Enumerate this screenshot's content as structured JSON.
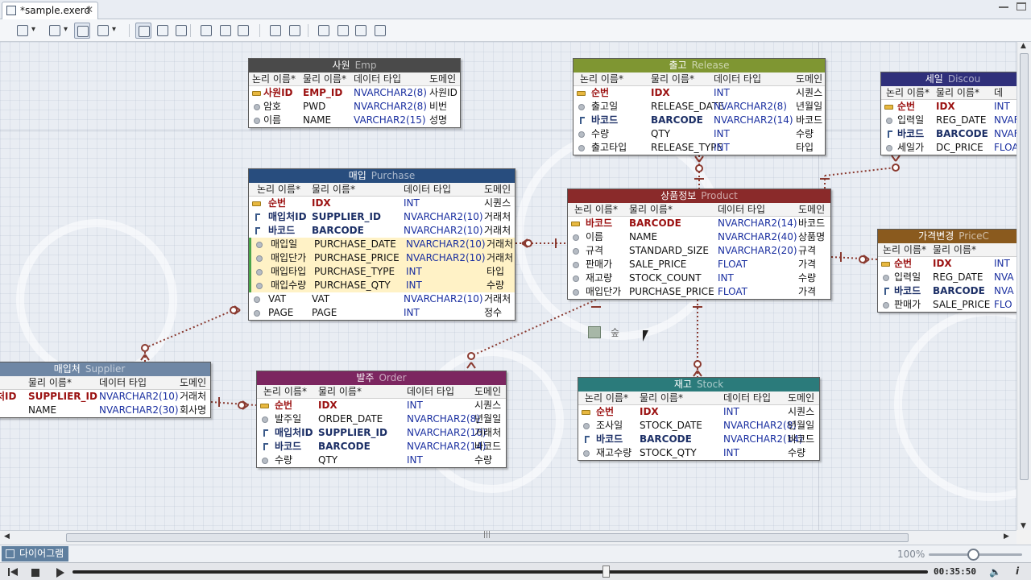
{
  "tabbar": {
    "file_tab": "*sample.exerd",
    "close": "✕"
  },
  "toolbar": {
    "icons": [
      "layout-icon",
      "paint-icon",
      "table-icon",
      "page-icon",
      "pointer-icon",
      "hand-icon",
      "zoom-icon",
      "entity-icon",
      "relation-icon",
      "link-icon",
      "text-icon",
      "print-icon",
      "export-icon",
      "import-icon",
      "sync-icon",
      "help-icon"
    ]
  },
  "colors": {
    "emp": "#4a4a4a",
    "release": "#7f9632",
    "product": "#8a2a2a",
    "purchase": "#284d7e",
    "discount": "#2f2f7a",
    "price": "#8a5a1e",
    "supplier": "#6f87a5",
    "order": "#7c2660",
    "stock": "#2b7b7b",
    "link": "#8a3a30"
  },
  "entities": [
    {
      "key": "emp",
      "ko": "사원",
      "en": "Emp",
      "cols": [
        "논리 이름*",
        "물리 이름*",
        "데이터 타입",
        "도메인"
      ],
      "rows": [
        {
          "kind": "pk",
          "logical": "사원ID",
          "physical": "EMP_ID",
          "type": "NVARCHAR2(8)",
          "domain": "사원ID"
        },
        {
          "kind": "n",
          "logical": "암호",
          "physical": "PWD",
          "type": "NVARCHAR2(8)",
          "domain": "비번"
        },
        {
          "kind": "n",
          "logical": "이름",
          "physical": "NAME",
          "type": "VARCHAR2(15)",
          "domain": "성명"
        }
      ]
    },
    {
      "key": "release",
      "ko": "출고",
      "en": "Release",
      "cols": [
        "논리 이름*",
        "물리 이름*",
        "데이터 타입",
        "도메인"
      ],
      "rows": [
        {
          "kind": "pk",
          "logical": "순번",
          "physical": "IDX",
          "type": "INT",
          "domain": "시퀀스"
        },
        {
          "kind": "n",
          "logical": "출고일",
          "physical": "RELEASE_DATE",
          "type": "NVARCHAR2(8)",
          "domain": "년월일"
        },
        {
          "kind": "fk",
          "logical": "바코드",
          "physical": "BARCODE",
          "type": "NVARCHAR2(14)",
          "domain": "바코드"
        },
        {
          "kind": "n",
          "logical": "수량",
          "physical": "QTY",
          "type": "INT",
          "domain": "수량"
        },
        {
          "kind": "n",
          "logical": "출고타입",
          "physical": "RELEASE_TYPE",
          "type": "INT",
          "domain": "타입"
        }
      ]
    },
    {
      "key": "discount",
      "ko": "세일",
      "en": "Discou",
      "cols": [
        "논리 이름*",
        "물리 이름*",
        "데"
      ],
      "rows": [
        {
          "kind": "pk",
          "logical": "순번",
          "physical": "IDX",
          "type": "INT",
          "domain": ""
        },
        {
          "kind": "n",
          "logical": "입력일",
          "physical": "REG_DATE",
          "type": "NVAF",
          "domain": ""
        },
        {
          "kind": "fk",
          "logical": "바코드",
          "physical": "BARCODE",
          "type": "NVAF",
          "domain": ""
        },
        {
          "kind": "n",
          "logical": "세일가",
          "physical": "DC_PRICE",
          "type": "FLOA",
          "domain": ""
        }
      ]
    },
    {
      "key": "purchase",
      "ko": "매입",
      "en": "Purchase",
      "cols": [
        "논리 이름*",
        "물리 이름*",
        "데이터 타입",
        "도메인"
      ],
      "rows": [
        {
          "kind": "pk",
          "logical": "순번",
          "physical": "IDX",
          "type": "INT",
          "domain": "시퀀스"
        },
        {
          "kind": "fk",
          "logical": "매입처ID",
          "physical": "SUPPLIER_ID",
          "type": "NVARCHAR2(10)",
          "domain": "거래처"
        },
        {
          "kind": "fk",
          "logical": "바코드",
          "physical": "BARCODE",
          "type": "NVARCHAR2(10)",
          "domain": "거래처"
        },
        {
          "kind": "n",
          "hl": true,
          "logical": "매입일",
          "physical": "PURCHASE_DATE",
          "type": "NVARCHAR2(10)",
          "domain": "거래처"
        },
        {
          "kind": "n",
          "hl": true,
          "logical": "매입단가",
          "physical": "PURCHASE_PRICE",
          "type": "NVARCHAR2(10)",
          "domain": "거래처"
        },
        {
          "kind": "n",
          "hl": true,
          "logical": "매입타입",
          "physical": "PURCHASE_TYPE",
          "type": "INT",
          "domain": "타입"
        },
        {
          "kind": "n",
          "hl": true,
          "logical": "매입수량",
          "physical": "PURCHASE_QTY",
          "type": "INT",
          "domain": "수량"
        },
        {
          "kind": "n",
          "logical": "VAT",
          "physical": "VAT",
          "type": "NVARCHAR2(10)",
          "domain": "거래처"
        },
        {
          "kind": "n",
          "logical": "PAGE",
          "physical": "PAGE",
          "type": "INT",
          "domain": "정수"
        }
      ]
    },
    {
      "key": "product",
      "ko": "상품정보",
      "en": "Product",
      "cols": [
        "논리 이름*",
        "물리 이름*",
        "데이터 타입",
        "도메인"
      ],
      "rows": [
        {
          "kind": "pk",
          "logical": "바코드",
          "physical": "BARCODE",
          "type": "NVARCHAR2(14)",
          "domain": "바코드"
        },
        {
          "kind": "n",
          "logical": "이름",
          "physical": "NAME",
          "type": "NVARCHAR2(40)",
          "domain": "상품명"
        },
        {
          "kind": "n",
          "logical": "규격",
          "physical": "STANDARD_SIZE",
          "type": "NVARCHAR2(20)",
          "domain": "규격"
        },
        {
          "kind": "n",
          "logical": "판매가",
          "physical": "SALE_PRICE",
          "type": "FLOAT",
          "domain": "가격"
        },
        {
          "kind": "n",
          "logical": "재고량",
          "physical": "STOCK_COUNT",
          "type": "INT",
          "domain": "수량"
        },
        {
          "kind": "n",
          "logical": "매입단가",
          "physical": "PURCHASE_PRICE",
          "type": "FLOAT",
          "domain": "가격"
        }
      ]
    },
    {
      "key": "price",
      "ko": "가격변경",
      "en": "PriceC",
      "cols": [
        "논리 이름*",
        "물리 이름*",
        ""
      ],
      "rows": [
        {
          "kind": "pk",
          "logical": "순번",
          "physical": "IDX",
          "type": "INT",
          "domain": ""
        },
        {
          "kind": "n",
          "logical": "입력일",
          "physical": "REG_DATE",
          "type": "NVA",
          "domain": ""
        },
        {
          "kind": "fk",
          "logical": "바코드",
          "physical": "BARCODE",
          "type": "NVA",
          "domain": ""
        },
        {
          "kind": "n",
          "logical": "판매가",
          "physical": "SALE_PRICE",
          "type": "FLO",
          "domain": ""
        }
      ]
    },
    {
      "key": "supplier",
      "ko": "매입처",
      "en": "Supplier",
      "cols": [
        "름*",
        "물리 이름*",
        "데이터 타입",
        "도메인"
      ],
      "rows": [
        {
          "kind": "pk",
          "logical": "처ID",
          "physical": "SUPPLIER_ID",
          "type": "NVARCHAR2(10)",
          "domain": "거래처"
        },
        {
          "kind": "n",
          "logical": "",
          "physical": "NAME",
          "type": "NVARCHAR2(30)",
          "domain": "회사명"
        }
      ]
    },
    {
      "key": "order",
      "ko": "발주",
      "en": "Order",
      "cols": [
        "논리 이름*",
        "물리 이름*",
        "데이터 타입",
        "도메인"
      ],
      "rows": [
        {
          "kind": "pk",
          "logical": "순번",
          "physical": "IDX",
          "type": "INT",
          "domain": "시퀀스"
        },
        {
          "kind": "n",
          "logical": "발주일",
          "physical": "ORDER_DATE",
          "type": "NVARCHAR2(8)",
          "domain": "년월일"
        },
        {
          "kind": "fk",
          "logical": "매입처ID",
          "physical": "SUPPLIER_ID",
          "type": "NVARCHAR2(10)",
          "domain": "거래처"
        },
        {
          "kind": "fk",
          "logical": "바코드",
          "physical": "BARCODE",
          "type": "NVARCHAR2(14)",
          "domain": "바코드"
        },
        {
          "kind": "n",
          "logical": "수량",
          "physical": "QTY",
          "type": "INT",
          "domain": "수량"
        }
      ]
    },
    {
      "key": "stock",
      "ko": "재고",
      "en": "Stock",
      "cols": [
        "논리 이름*",
        "물리 이름*",
        "데이터 타입",
        "도메인"
      ],
      "rows": [
        {
          "kind": "pk",
          "logical": "순번",
          "physical": "IDX",
          "type": "INT",
          "domain": "시퀀스"
        },
        {
          "kind": "n",
          "logical": "조사일",
          "physical": "STOCK_DATE",
          "type": "NVARCHAR2(8)",
          "domain": "년월일"
        },
        {
          "kind": "fk",
          "logical": "바코드",
          "physical": "BARCODE",
          "type": "NVARCHAR2(14)",
          "domain": "바코드"
        },
        {
          "kind": "n",
          "logical": "재고수량",
          "physical": "STOCK_QTY",
          "type": "INT",
          "domain": "수량"
        }
      ]
    }
  ],
  "note": {
    "text": "숲"
  },
  "statusbar": {
    "diagram_tab": "다이어그램",
    "zoom": "100%"
  },
  "player": {
    "time": "00:35:50",
    "info": "i",
    "progress": 0.62
  }
}
